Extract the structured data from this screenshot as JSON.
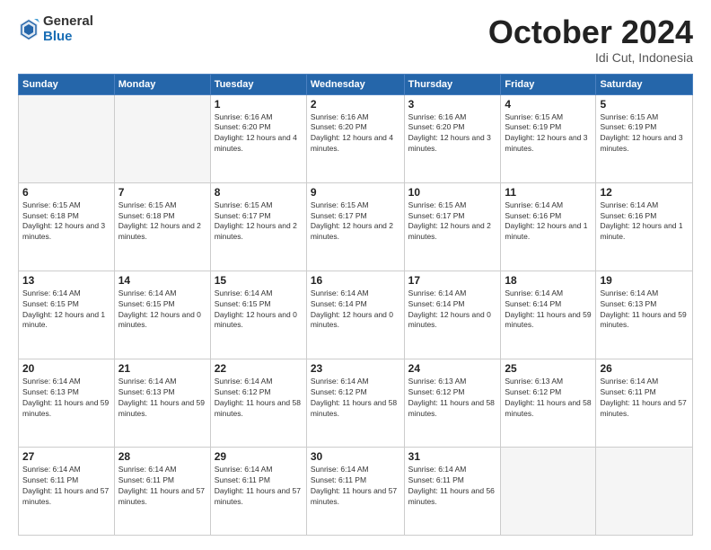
{
  "logo": {
    "general": "General",
    "blue": "Blue"
  },
  "header": {
    "month": "October 2024",
    "location": "Idi Cut, Indonesia"
  },
  "weekdays": [
    "Sunday",
    "Monday",
    "Tuesday",
    "Wednesday",
    "Thursday",
    "Friday",
    "Saturday"
  ],
  "weeks": [
    [
      {
        "day": "",
        "empty": true
      },
      {
        "day": "",
        "empty": true
      },
      {
        "day": "1",
        "sunrise": "6:16 AM",
        "sunset": "6:20 PM",
        "daylight": "12 hours and 4 minutes."
      },
      {
        "day": "2",
        "sunrise": "6:16 AM",
        "sunset": "6:20 PM",
        "daylight": "12 hours and 4 minutes."
      },
      {
        "day": "3",
        "sunrise": "6:16 AM",
        "sunset": "6:20 PM",
        "daylight": "12 hours and 3 minutes."
      },
      {
        "day": "4",
        "sunrise": "6:15 AM",
        "sunset": "6:19 PM",
        "daylight": "12 hours and 3 minutes."
      },
      {
        "day": "5",
        "sunrise": "6:15 AM",
        "sunset": "6:19 PM",
        "daylight": "12 hours and 3 minutes."
      }
    ],
    [
      {
        "day": "6",
        "sunrise": "6:15 AM",
        "sunset": "6:18 PM",
        "daylight": "12 hours and 3 minutes."
      },
      {
        "day": "7",
        "sunrise": "6:15 AM",
        "sunset": "6:18 PM",
        "daylight": "12 hours and 2 minutes."
      },
      {
        "day": "8",
        "sunrise": "6:15 AM",
        "sunset": "6:17 PM",
        "daylight": "12 hours and 2 minutes."
      },
      {
        "day": "9",
        "sunrise": "6:15 AM",
        "sunset": "6:17 PM",
        "daylight": "12 hours and 2 minutes."
      },
      {
        "day": "10",
        "sunrise": "6:15 AM",
        "sunset": "6:17 PM",
        "daylight": "12 hours and 2 minutes."
      },
      {
        "day": "11",
        "sunrise": "6:14 AM",
        "sunset": "6:16 PM",
        "daylight": "12 hours and 1 minute."
      },
      {
        "day": "12",
        "sunrise": "6:14 AM",
        "sunset": "6:16 PM",
        "daylight": "12 hours and 1 minute."
      }
    ],
    [
      {
        "day": "13",
        "sunrise": "6:14 AM",
        "sunset": "6:15 PM",
        "daylight": "12 hours and 1 minute."
      },
      {
        "day": "14",
        "sunrise": "6:14 AM",
        "sunset": "6:15 PM",
        "daylight": "12 hours and 0 minutes."
      },
      {
        "day": "15",
        "sunrise": "6:14 AM",
        "sunset": "6:15 PM",
        "daylight": "12 hours and 0 minutes."
      },
      {
        "day": "16",
        "sunrise": "6:14 AM",
        "sunset": "6:14 PM",
        "daylight": "12 hours and 0 minutes."
      },
      {
        "day": "17",
        "sunrise": "6:14 AM",
        "sunset": "6:14 PM",
        "daylight": "12 hours and 0 minutes."
      },
      {
        "day": "18",
        "sunrise": "6:14 AM",
        "sunset": "6:14 PM",
        "daylight": "11 hours and 59 minutes."
      },
      {
        "day": "19",
        "sunrise": "6:14 AM",
        "sunset": "6:13 PM",
        "daylight": "11 hours and 59 minutes."
      }
    ],
    [
      {
        "day": "20",
        "sunrise": "6:14 AM",
        "sunset": "6:13 PM",
        "daylight": "11 hours and 59 minutes."
      },
      {
        "day": "21",
        "sunrise": "6:14 AM",
        "sunset": "6:13 PM",
        "daylight": "11 hours and 59 minutes."
      },
      {
        "day": "22",
        "sunrise": "6:14 AM",
        "sunset": "6:12 PM",
        "daylight": "11 hours and 58 minutes."
      },
      {
        "day": "23",
        "sunrise": "6:14 AM",
        "sunset": "6:12 PM",
        "daylight": "11 hours and 58 minutes."
      },
      {
        "day": "24",
        "sunrise": "6:13 AM",
        "sunset": "6:12 PM",
        "daylight": "11 hours and 58 minutes."
      },
      {
        "day": "25",
        "sunrise": "6:13 AM",
        "sunset": "6:12 PM",
        "daylight": "11 hours and 58 minutes."
      },
      {
        "day": "26",
        "sunrise": "6:14 AM",
        "sunset": "6:11 PM",
        "daylight": "11 hours and 57 minutes."
      }
    ],
    [
      {
        "day": "27",
        "sunrise": "6:14 AM",
        "sunset": "6:11 PM",
        "daylight": "11 hours and 57 minutes."
      },
      {
        "day": "28",
        "sunrise": "6:14 AM",
        "sunset": "6:11 PM",
        "daylight": "11 hours and 57 minutes."
      },
      {
        "day": "29",
        "sunrise": "6:14 AM",
        "sunset": "6:11 PM",
        "daylight": "11 hours and 57 minutes."
      },
      {
        "day": "30",
        "sunrise": "6:14 AM",
        "sunset": "6:11 PM",
        "daylight": "11 hours and 57 minutes."
      },
      {
        "day": "31",
        "sunrise": "6:14 AM",
        "sunset": "6:11 PM",
        "daylight": "11 hours and 56 minutes."
      },
      {
        "day": "",
        "empty": true
      },
      {
        "day": "",
        "empty": true
      }
    ]
  ]
}
